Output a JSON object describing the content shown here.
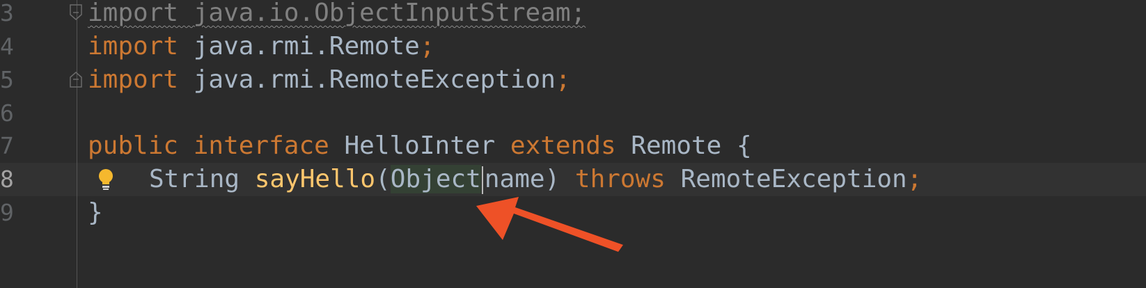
{
  "editor": {
    "lines": [
      {
        "number": "3",
        "tokens": [
          {
            "text": "import java.io.ObjectInputStream;",
            "style": "faded"
          }
        ]
      },
      {
        "number": "4",
        "tokens": [
          {
            "text": "import",
            "style": "kw"
          },
          {
            "text": " java.rmi.Remote",
            "style": "ident"
          },
          {
            "text": ";",
            "style": "punct"
          }
        ]
      },
      {
        "number": "5",
        "tokens": [
          {
            "text": "import",
            "style": "kw"
          },
          {
            "text": " java.rmi.RemoteException",
            "style": "ident"
          },
          {
            "text": ";",
            "style": "punct"
          }
        ]
      },
      {
        "number": "6",
        "tokens": []
      },
      {
        "number": "7",
        "tokens": [
          {
            "text": "public",
            "style": "kw"
          },
          {
            "text": " ",
            "style": "ident"
          },
          {
            "text": "interface",
            "style": "kw"
          },
          {
            "text": " HelloInter ",
            "style": "ident"
          },
          {
            "text": "extends",
            "style": "kw"
          },
          {
            "text": " Remote {",
            "style": "ident"
          }
        ]
      },
      {
        "number": "8",
        "current": true,
        "indented": true,
        "tokens": [
          {
            "text": "String ",
            "style": "ident"
          },
          {
            "text": "sayHello",
            "style": "method"
          },
          {
            "text": "(",
            "style": "ident"
          },
          {
            "text": "Object",
            "style": "param-type"
          },
          {
            "caret": true
          },
          {
            "text": "name) ",
            "style": "ident"
          },
          {
            "text": "throws",
            "style": "kw"
          },
          {
            "text": " RemoteException",
            "style": "ident"
          },
          {
            "text": ";",
            "style": "punct"
          }
        ]
      },
      {
        "number": "9",
        "tokens": [
          {
            "text": "}",
            "style": "ident"
          }
        ]
      }
    ],
    "fold_markers": [
      "3",
      "5"
    ],
    "intention_bulb_line": "8"
  },
  "annotation": {
    "arrow_color": "#EE5127",
    "points_to": "Object"
  },
  "colors": {
    "background": "#2B2B2B",
    "keyword": "#CC7832",
    "identifier": "#A9B7C6",
    "method": "#FFC66D",
    "line_number": "#606366",
    "param_highlight": "#344134"
  }
}
